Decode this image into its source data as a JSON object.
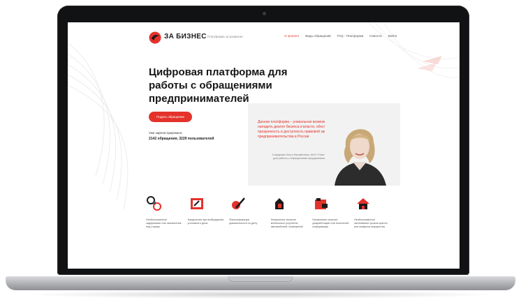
{
  "header": {
    "logo_text": "ЗА БИЗНЕС",
    "tagline": "Платформа за развитие",
    "nav": [
      {
        "label": "О проекте",
        "active": true
      },
      {
        "label": "Виды обращений",
        "active": false
      },
      {
        "label": "FAQ - Платформа",
        "active": false
      },
      {
        "label": "Новости",
        "active": false
      },
      {
        "label": "Войти",
        "active": false
      }
    ]
  },
  "hero": {
    "title": "Цифровая платформа для работы с обращениями предпринимателей",
    "cta_label": "Подать обращение",
    "stats_label": "Уже зарегистрировано:",
    "stats_value": "2142 обращения, 3229 пользователей"
  },
  "quote": {
    "text": "Данная платформа – уникальная возможность наладить диалог бизнеса и власти, обеспечить прозрачность и доступность правовой защиты предпринимательства в России",
    "author": "Сафарова Ольга Михайловна, АНО «Платформа для работы с обращениями предпринимателей»"
  },
  "features": [
    {
      "icon": "handcuffs-icon",
      "label": "Необоснованное задержание или заключение под стражу"
    },
    {
      "icon": "document-icon",
      "label": "Нарушения при возбуждении уголовного дела"
    },
    {
      "icon": "pen-icon",
      "label": "Фальсификация доказательств по делу"
    },
    {
      "icon": "hands-icon",
      "label": "Незаконное изъятие мобильных устройств, автомобилей, помещений"
    },
    {
      "icon": "folder-icon",
      "label": "Незаконное изъятие документации или носителей информации"
    },
    {
      "icon": "house-icon",
      "label": "Необоснованное затягивание сроков ареста или возврата имущества"
    }
  ],
  "colors": {
    "accent": "#e4322b",
    "text": "#161616",
    "muted": "#777777"
  }
}
